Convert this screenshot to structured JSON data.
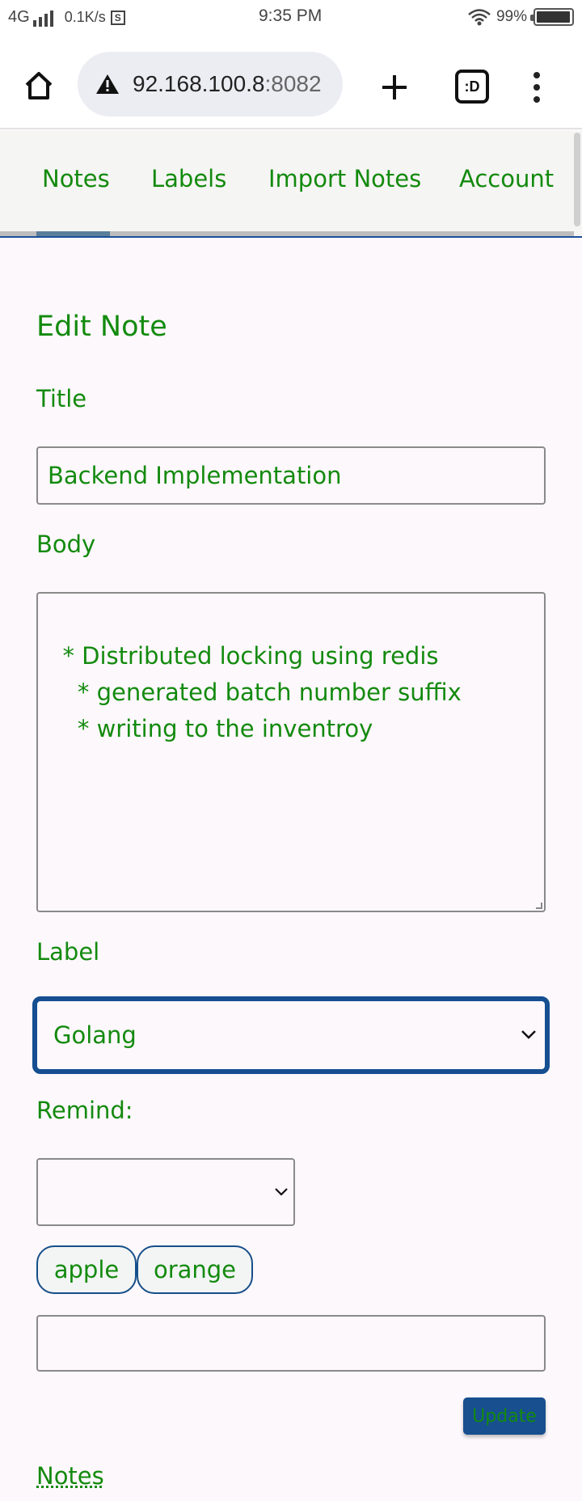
{
  "status_bar": {
    "network": "4G",
    "speed": "0.1K/s",
    "time": "9:35 PM",
    "battery": "99%"
  },
  "browser": {
    "url_host": "92.168.100.8",
    "url_port": ":8082",
    "tab_switcher_label": ":D"
  },
  "nav": {
    "tabs": [
      {
        "label": "Notes"
      },
      {
        "label": "Labels"
      },
      {
        "label": "Import Notes"
      },
      {
        "label": "Account"
      }
    ],
    "active_tab": "Notes"
  },
  "form": {
    "heading": "Edit Note",
    "title_label": "Title",
    "title_value": "Backend Implementation",
    "body_label": "Body",
    "body_value": "* Distributed locking using redis\n    * generated batch number suffix\n    * writing to the inventroy",
    "label_label": "Label",
    "label_value": "Golang",
    "remind_label": "Remind:",
    "remind_value": "",
    "tags": [
      "apple",
      "orange"
    ],
    "tag_input_value": "",
    "update_label": "Update"
  },
  "footer": {
    "link_label": "Notes"
  },
  "colors": {
    "text_green": "#138a0e",
    "accent_blue": "#154e91",
    "page_bg": "#fdf8fc"
  }
}
